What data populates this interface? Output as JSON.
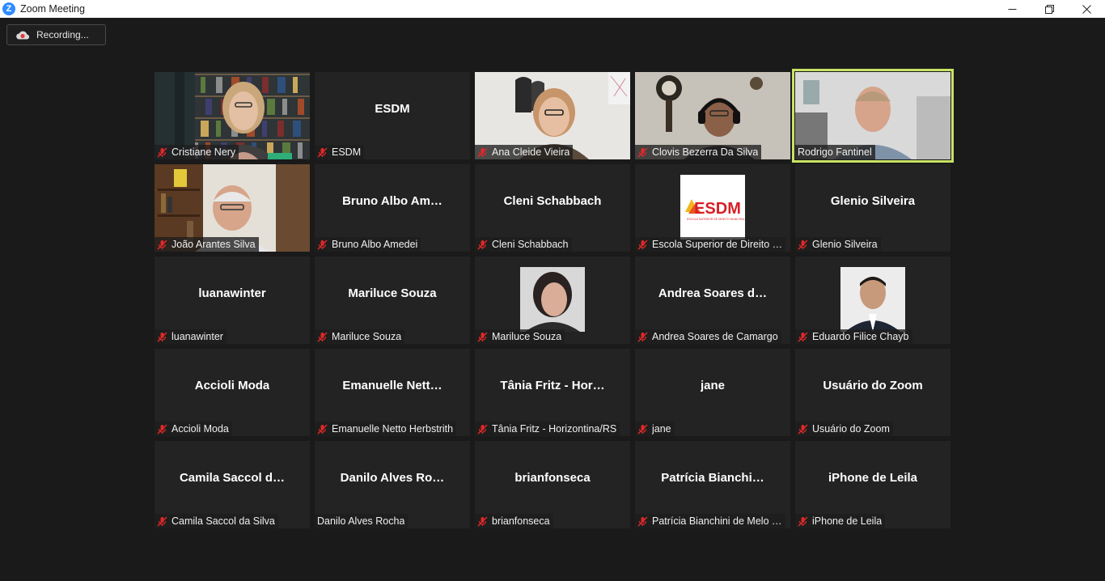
{
  "window": {
    "title": "Zoom Meeting",
    "icon_letter": "Z"
  },
  "recording": {
    "label": "Recording..."
  },
  "colors": {
    "speaking_border": "#c8e264",
    "mute_red": "#e02828"
  },
  "participants": [
    {
      "display": "",
      "name": "Cristiane Nery",
      "muted": true,
      "video": "bookshelf-woman"
    },
    {
      "display": "ESDM",
      "name": "ESDM",
      "muted": true,
      "video": ""
    },
    {
      "display": "",
      "name": "Ana Cleide Vieira",
      "muted": true,
      "video": "wall-woman"
    },
    {
      "display": "",
      "name": "Clovis Bezerra Da Silva",
      "muted": true,
      "video": "headset-man"
    },
    {
      "display": "",
      "name": "Rodrigo Fantinel",
      "muted": false,
      "video": "office-man",
      "speaking": true
    },
    {
      "display": "",
      "name": "João Arantes Silva",
      "muted": true,
      "video": "shelf-man"
    },
    {
      "display": "Bruno Albo Am…",
      "name": "Bruno Albo Amedei",
      "muted": true,
      "video": ""
    },
    {
      "display": "Cleni Schabbach",
      "name": "Cleni Schabbach",
      "muted": true,
      "video": ""
    },
    {
      "display": "",
      "name": "Escola Superior de Direito …",
      "muted": true,
      "video": "esdm-logo",
      "logo_text": "ESDM",
      "logo_sub": "ESCOLA SUPERIOR DE DIREITO MUNICIPAL"
    },
    {
      "display": "Glenio Silveira",
      "name": "Glenio Silveira",
      "muted": true,
      "video": ""
    },
    {
      "display": "luanawinter",
      "name": "luanawinter",
      "muted": true,
      "video": ""
    },
    {
      "display": "Mariluce Souza",
      "name": "Mariluce Souza",
      "muted": true,
      "video": ""
    },
    {
      "display": "",
      "name": "Mariluce Souza",
      "muted": true,
      "video": "portrait-woman"
    },
    {
      "display": "Andrea Soares d…",
      "name": "Andrea Soares de Camargo",
      "muted": true,
      "video": ""
    },
    {
      "display": "",
      "name": "Eduardo Filice Chayb",
      "muted": true,
      "video": "portrait-man"
    },
    {
      "display": "Accioli Moda",
      "name": "Accioli Moda",
      "muted": true,
      "video": ""
    },
    {
      "display": "Emanuelle  Nett…",
      "name": "Emanuelle Netto Herbstrith",
      "muted": true,
      "video": ""
    },
    {
      "display": "Tânia Fritz - Hor…",
      "name": "Tânia Fritz - Horizontina/RS",
      "muted": true,
      "video": ""
    },
    {
      "display": "jane",
      "name": "jane",
      "muted": true,
      "video": ""
    },
    {
      "display": "Usuário do Zoom",
      "name": "Usuário do Zoom",
      "muted": true,
      "video": ""
    },
    {
      "display": "Camila Saccol d…",
      "name": "Camila Saccol da Silva",
      "muted": true,
      "video": ""
    },
    {
      "display": "Danilo Alves Ro…",
      "name": "Danilo Alves Rocha",
      "muted": false,
      "video": ""
    },
    {
      "display": "brianfonseca",
      "name": "brianfonseca",
      "muted": true,
      "video": ""
    },
    {
      "display": "Patrícia  Bianchi…",
      "name": "Patrícia Bianchini de Melo …",
      "muted": true,
      "video": ""
    },
    {
      "display": "iPhone de Leila",
      "name": "iPhone de Leila",
      "muted": true,
      "video": ""
    }
  ]
}
